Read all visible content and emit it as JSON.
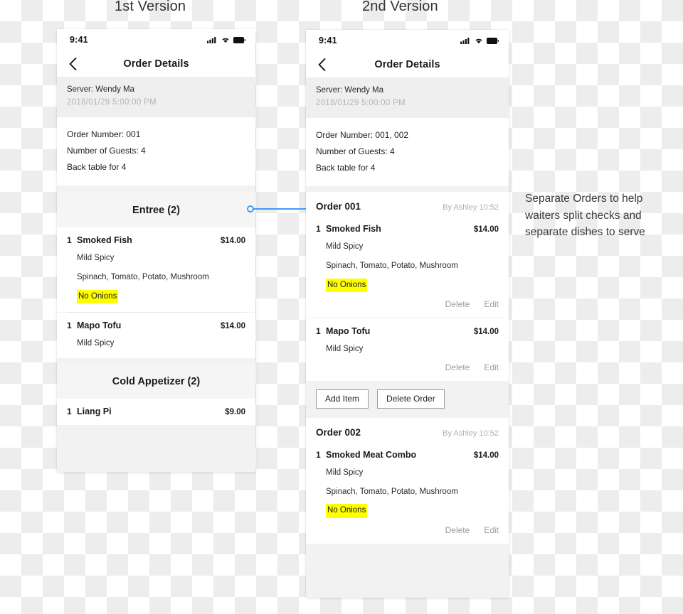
{
  "captions": {
    "version_1": "1st Version",
    "version_2": "2nd Version"
  },
  "annotation": {
    "text": "Separate Orders to help waiters split checks and separate dishes to serve"
  },
  "connector": {
    "color": "#3f9cf0"
  },
  "phone_1": {
    "statusbar": {
      "clock": "9:41",
      "icons": [
        "cellular-signal-icon",
        "wifi-icon",
        "battery-icon"
      ]
    },
    "navbar": {
      "back_icon": "chevron-left-icon",
      "title": "Order Details"
    },
    "server": {
      "name": "Server: Wendy Ma",
      "datetime": "2018/01/29   5:00:00 PM"
    },
    "info": {
      "order_number": "Order Number: 001",
      "guests": "Number of Guests: 4",
      "table": "Back table for 4"
    },
    "sections": [
      {
        "header": "Entree (2)",
        "dishes": [
          {
            "qty": "1",
            "name": "Smoked Fish",
            "price": "$14.00",
            "options": [
              "Mild Spicy",
              "Spinach, Tomato, Potato, Mushroom"
            ],
            "note": "No Onions"
          },
          {
            "qty": "1",
            "name": "Mapo Tofu",
            "price": "$14.00",
            "options": [
              "Mild Spicy"
            ],
            "note": ""
          }
        ]
      },
      {
        "header": "Cold Appetizer (2)",
        "dishes": [
          {
            "qty": "1",
            "name": "Liang Pi",
            "price": "$9.00",
            "options": [],
            "note": ""
          }
        ]
      }
    ]
  },
  "phone_2": {
    "statusbar": {
      "clock": "9:41",
      "icons": [
        "cellular-signal-icon",
        "wifi-icon",
        "battery-icon"
      ]
    },
    "navbar": {
      "back_icon": "chevron-left-icon",
      "title": "Order Details"
    },
    "server": {
      "name": "Server: Wendy Ma",
      "datetime": "2018/01/29   5:00:00 PM"
    },
    "info": {
      "order_number": "Order Number: 001, 002",
      "guests": "Number of Guests: 4",
      "table": "Back table for 4"
    },
    "actions": {
      "delete_label": "Delete",
      "edit_label": "Edit"
    },
    "buttons": {
      "add_item": "Add Item",
      "delete_order": "Delete Order"
    },
    "orders": [
      {
        "label": "Order 001",
        "meta": "By Ashley 10:52",
        "dishes": [
          {
            "qty": "1",
            "name": "Smoked Fish",
            "price": "$14.00",
            "options": [
              "Mild Spicy",
              "Spinach, Tomato, Potato, Mushroom"
            ],
            "note": "No Onions"
          },
          {
            "qty": "1",
            "name": "Mapo Tofu",
            "price": "$14.00",
            "options": [
              "Mild Spicy"
            ],
            "note": ""
          }
        ]
      },
      {
        "label": "Order 002",
        "meta": "By Ashley 10:52",
        "dishes": [
          {
            "qty": "1",
            "name": "Smoked Meat Combo",
            "price": "$14.00",
            "options": [
              "Mild Spicy",
              "Spinach, Tomato, Potato, Mushroom"
            ],
            "note": "No Onions"
          }
        ]
      }
    ]
  }
}
